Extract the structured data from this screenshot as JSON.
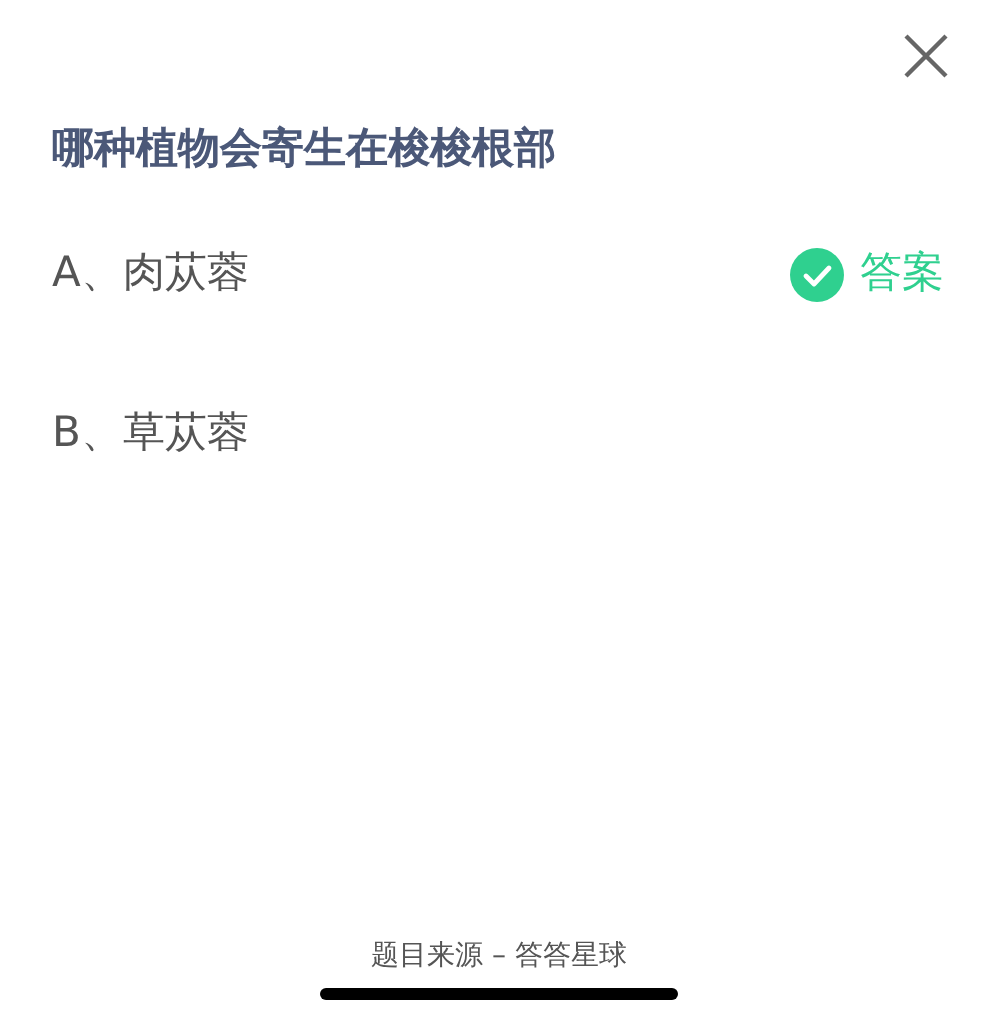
{
  "question": {
    "title": "哪种植物会寄生在梭梭根部"
  },
  "options": [
    {
      "label": "A、肉苁蓉",
      "correct": true,
      "answer_label": "答案"
    },
    {
      "label": "B、草苁蓉",
      "correct": false
    }
  ],
  "footer": "题目来源 – 答答星球"
}
